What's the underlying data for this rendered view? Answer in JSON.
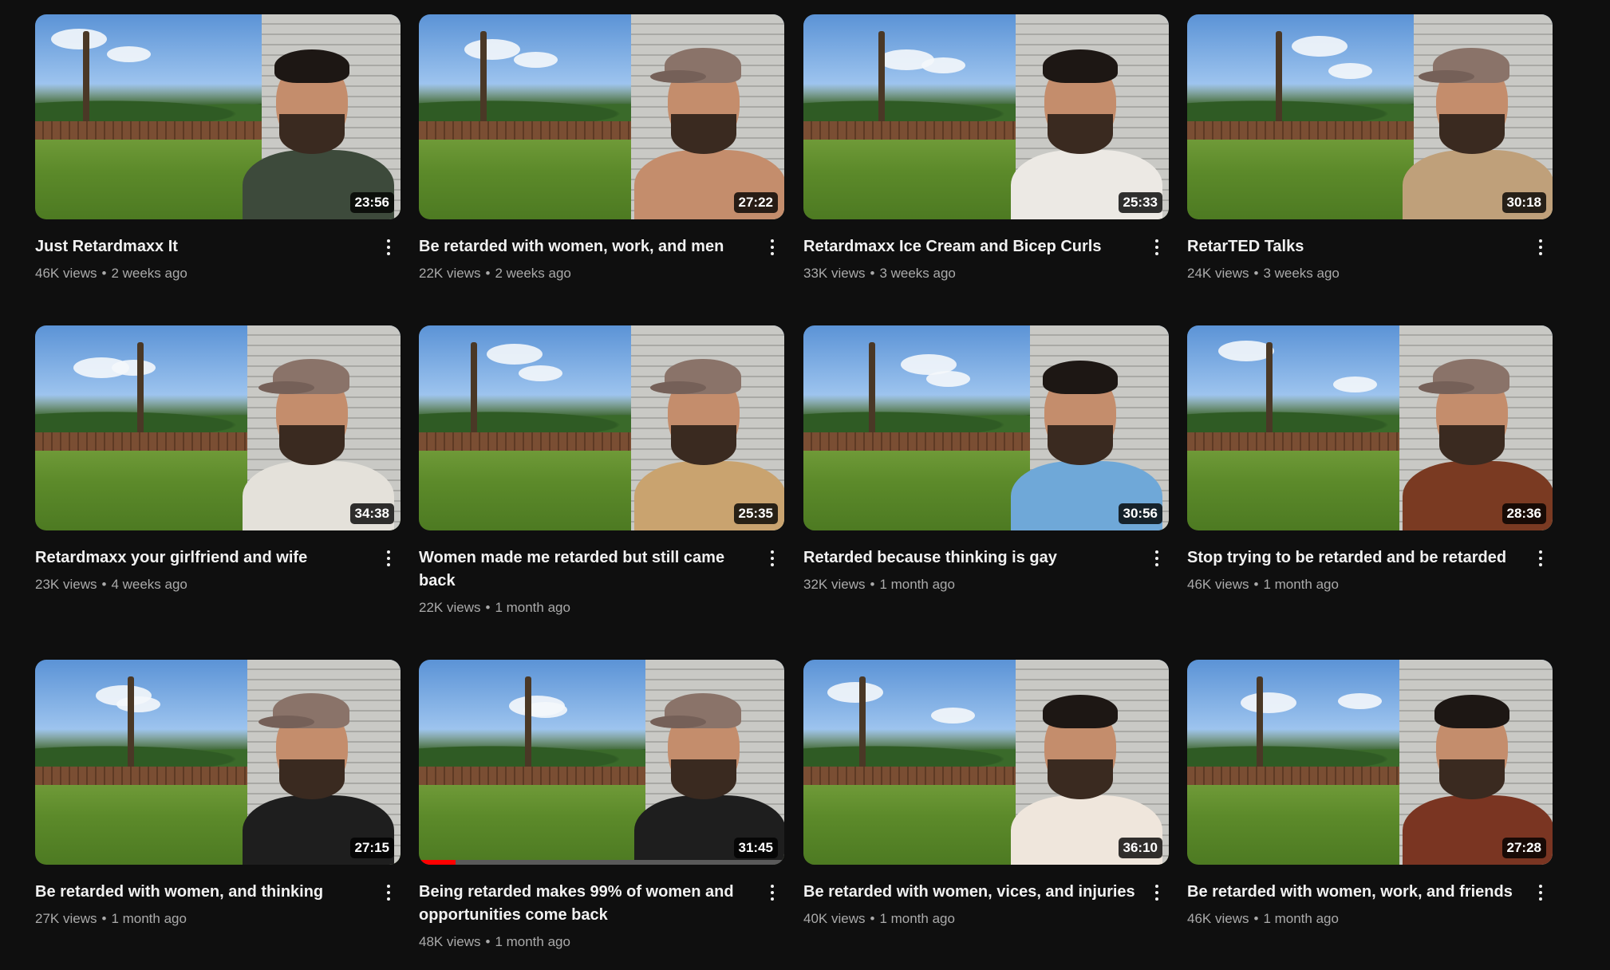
{
  "videos": [
    {
      "title": "Just Retardmaxx It",
      "views": "46K views",
      "age": "2 weeks ago",
      "duration": "23:56",
      "style": "hair",
      "shirt": "#3d4a3b"
    },
    {
      "title": "Be retarded with women, work, and men",
      "views": "22K views",
      "age": "2 weeks ago",
      "duration": "27:22",
      "style": "cap",
      "shirt": "#c48d6c"
    },
    {
      "title": "Retardmaxx Ice Cream and Bicep Curls",
      "views": "33K views",
      "age": "3 weeks ago",
      "duration": "25:33",
      "style": "hair",
      "shirt": "#ece9e4"
    },
    {
      "title": "RetarTED Talks",
      "views": "24K views",
      "age": "3 weeks ago",
      "duration": "30:18",
      "style": "cap",
      "shirt": "#bfa07a"
    },
    {
      "title": "Retardmaxx your girlfriend and wife",
      "views": "23K views",
      "age": "4 weeks ago",
      "duration": "34:38",
      "style": "cap",
      "shirt": "#e4e1da"
    },
    {
      "title": "Women made me retarded but still came back",
      "views": "22K views",
      "age": "1 month ago",
      "duration": "25:35",
      "style": "cap",
      "shirt": "#c9a36f"
    },
    {
      "title": "Retarded because thinking is gay",
      "views": "32K views",
      "age": "1 month ago",
      "duration": "30:56",
      "style": "hair",
      "shirt": "#6fa8d8"
    },
    {
      "title": "Stop trying to be retarded and be retarded",
      "views": "46K views",
      "age": "1 month ago",
      "duration": "28:36",
      "style": "cap",
      "shirt": "#7a3a22"
    },
    {
      "title": "Be retarded with women, and thinking",
      "views": "27K views",
      "age": "1 month ago",
      "duration": "27:15",
      "style": "cap",
      "shirt": "#1e1e1e"
    },
    {
      "title": "Being retarded makes 99% of women and opportunities come back",
      "views": "48K views",
      "age": "1 month ago",
      "duration": "31:45",
      "style": "cap",
      "shirt": "#1e1e1e",
      "progress": 0.1
    },
    {
      "title": "Be retarded with women, vices, and injuries",
      "views": "40K views",
      "age": "1 month ago",
      "duration": "36:10",
      "style": "hair",
      "shirt": "#efe6dc"
    },
    {
      "title": "Be retarded with women, work, and friends",
      "views": "46K views",
      "age": "1 month ago",
      "duration": "27:28",
      "style": "hair",
      "shirt": "#7a3522"
    }
  ],
  "separator": "•",
  "icons": {
    "menu": "three-dot-vertical-icon"
  }
}
